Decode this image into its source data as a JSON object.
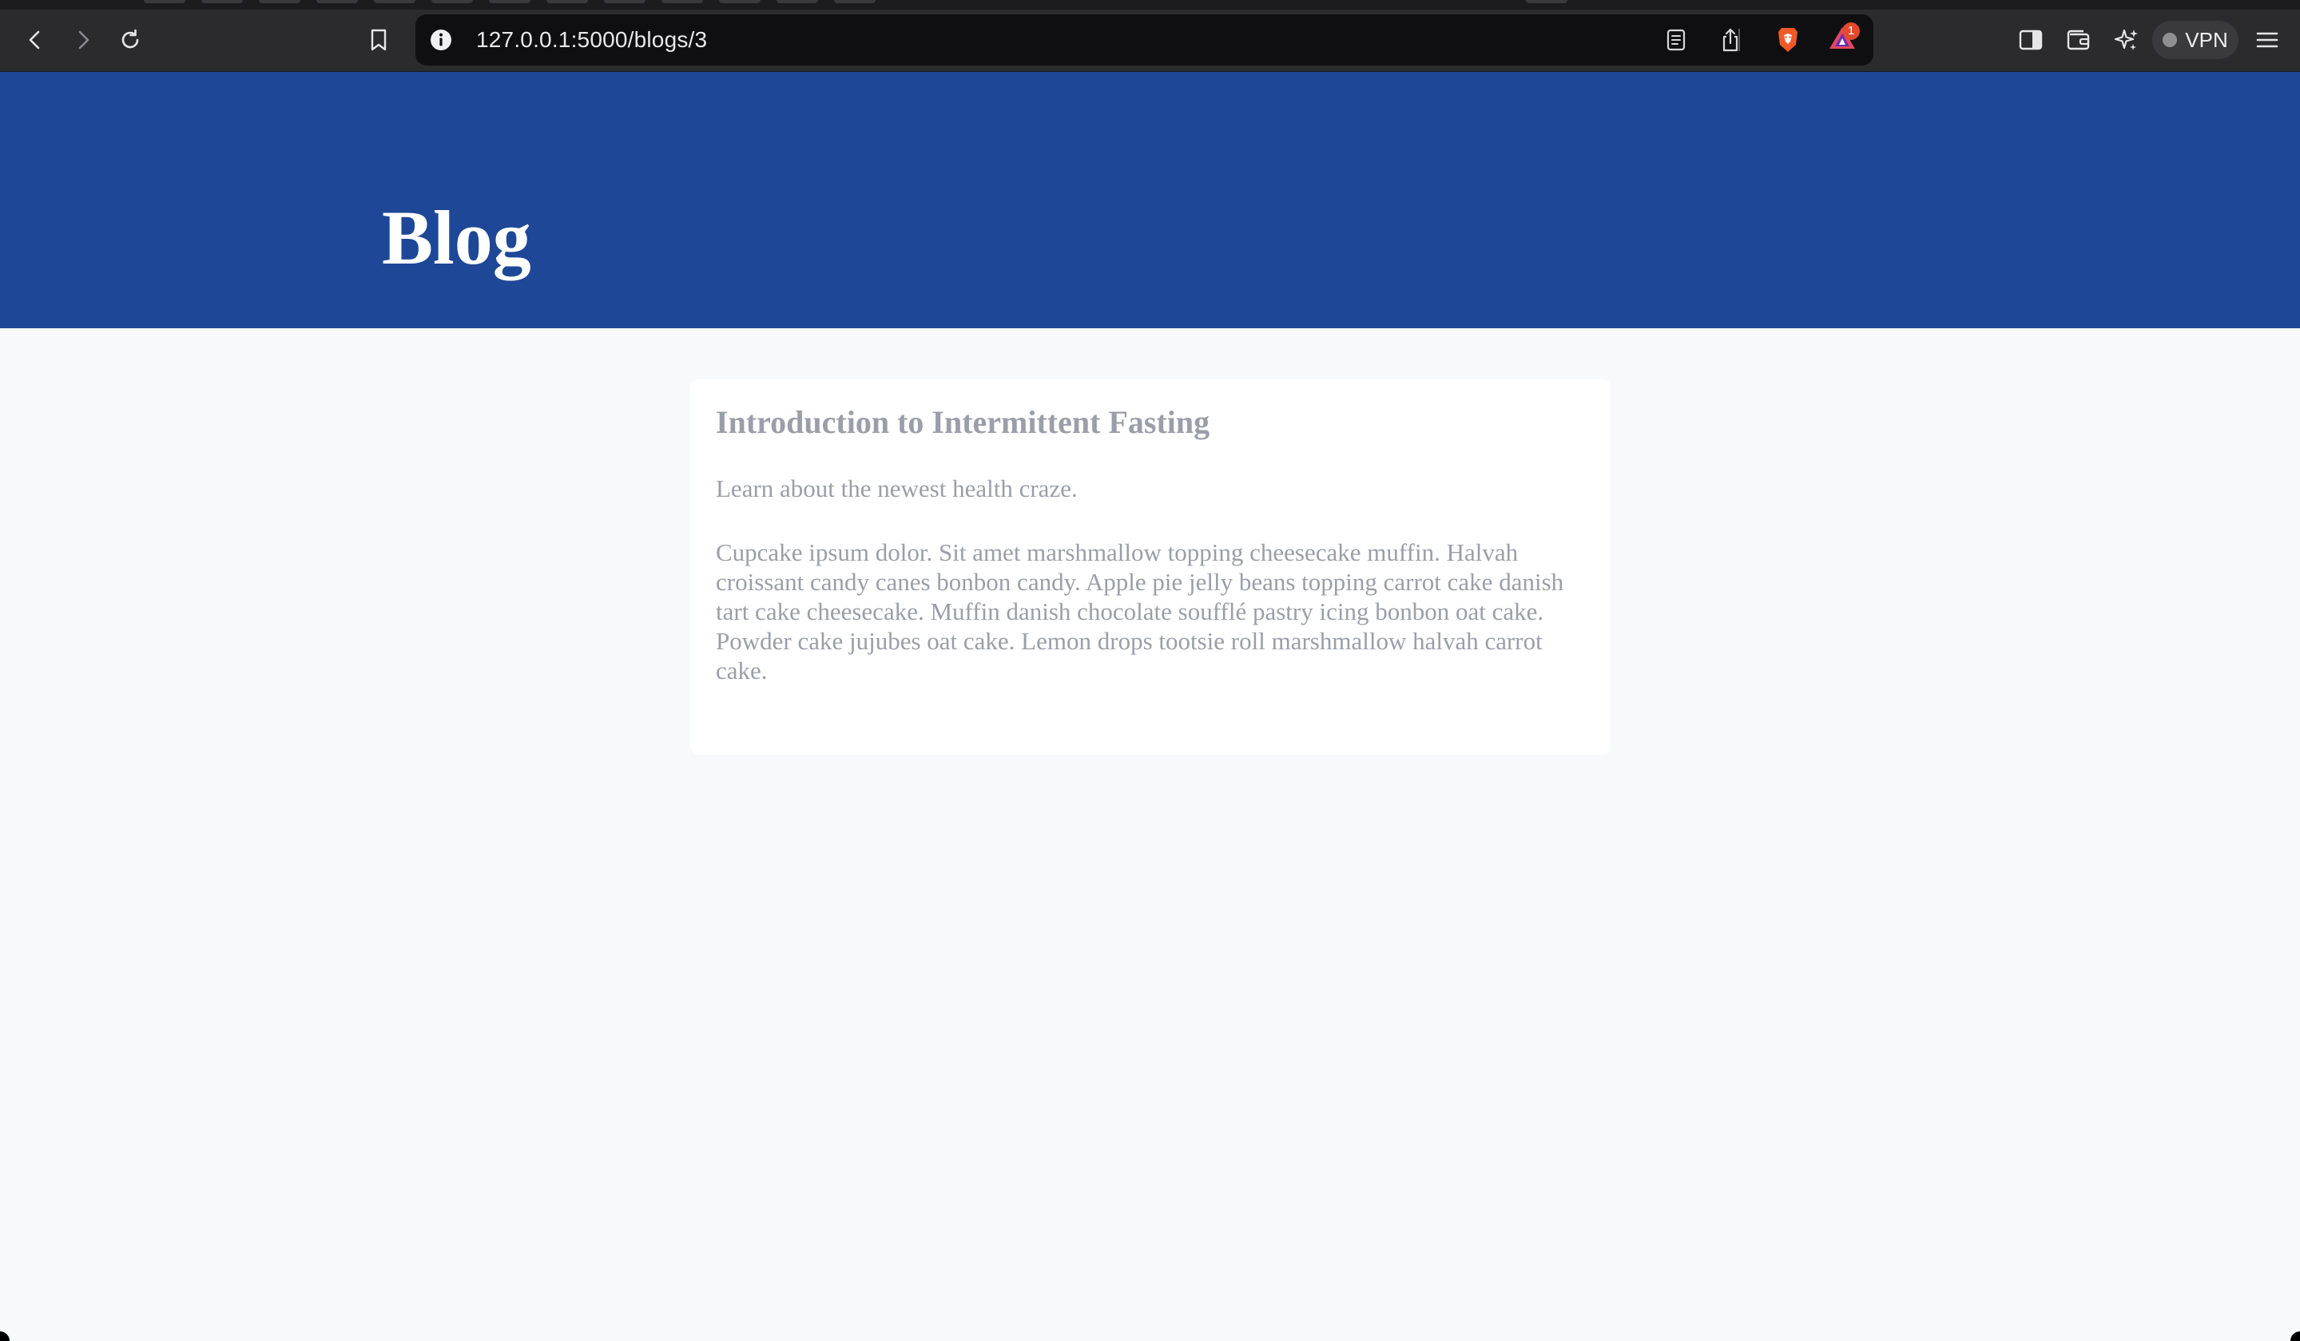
{
  "browser": {
    "url": "127.0.0.1:5000/blogs/3",
    "notification_count": "1",
    "vpn_label": "VPN",
    "icons": {
      "back": "chevron-left-icon",
      "forward": "chevron-right-icon",
      "reload": "reload-icon",
      "bookmark": "bookmark-icon",
      "site_info": "info-icon",
      "reader": "reader-mode-icon",
      "share": "share-icon",
      "shields": "brave-shields-icon",
      "rewards": "brave-rewards-icon",
      "sidebar": "sidebar-icon",
      "wallet": "wallet-icon",
      "leo": "sparkle-icon",
      "menu": "hamburger-menu-icon"
    }
  },
  "page": {
    "hero_title": "Blog",
    "post": {
      "title": "Introduction to Intermittent Fasting",
      "subtitle": "Learn about the newest health craze.",
      "body": "Cupcake ipsum dolor. Sit amet marshmallow topping cheesecake muffin. Halvah croissant candy canes bonbon candy. Apple pie jelly beans topping carrot cake danish tart cake cheesecake. Muffin danish chocolate soufflé pastry icing bonbon oat cake. Powder cake jujubes oat cake. Lemon drops tootsie roll marshmallow halvah carrot cake."
    }
  },
  "colors": {
    "hero_bg": "#1e4797",
    "page_bg": "#f8f9fb",
    "card_bg": "#ffffff",
    "muted_text": "#9a9ea8",
    "toolbar_bg": "#2b2b2e",
    "urlbar_bg": "#0f0f11",
    "badge": "#e2492f"
  }
}
